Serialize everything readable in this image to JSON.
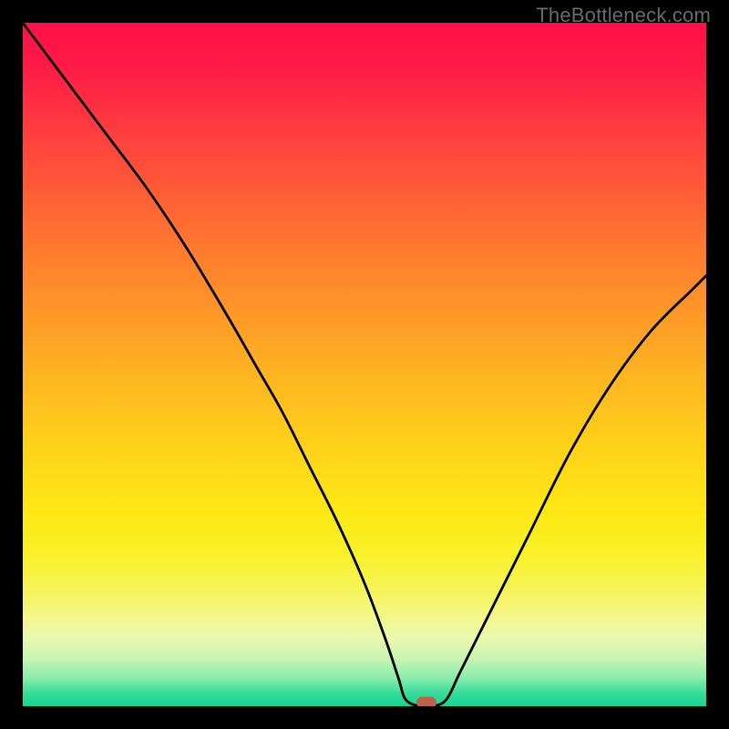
{
  "watermark": "TheBottleneck.com",
  "chart_data": {
    "type": "line",
    "title": "",
    "xlabel": "",
    "ylabel": "",
    "xlim": [
      0,
      100
    ],
    "ylim": [
      0,
      100
    ],
    "grid": false,
    "legend": false,
    "series": [
      {
        "name": "bottleneck-curve",
        "x": [
          0,
          6,
          12,
          18,
          24,
          30,
          34,
          38,
          42,
          46,
          50,
          53,
          55,
          56,
          58,
          60,
          62,
          64,
          68,
          74,
          80,
          86,
          92,
          98,
          100
        ],
        "y": [
          100,
          92,
          84,
          76,
          67,
          57,
          50,
          43,
          35,
          27,
          18,
          10,
          4,
          1,
          0,
          0,
          1,
          5,
          13,
          25,
          37,
          47,
          55,
          61,
          63
        ]
      }
    ],
    "marker": {
      "x": 59,
      "y": 0.5
    },
    "colors": {
      "curve": "#000000",
      "marker": "#c0604f",
      "gradient_top": "#ff1249",
      "gradient_bottom": "#14d592",
      "frame": "#000000"
    }
  }
}
